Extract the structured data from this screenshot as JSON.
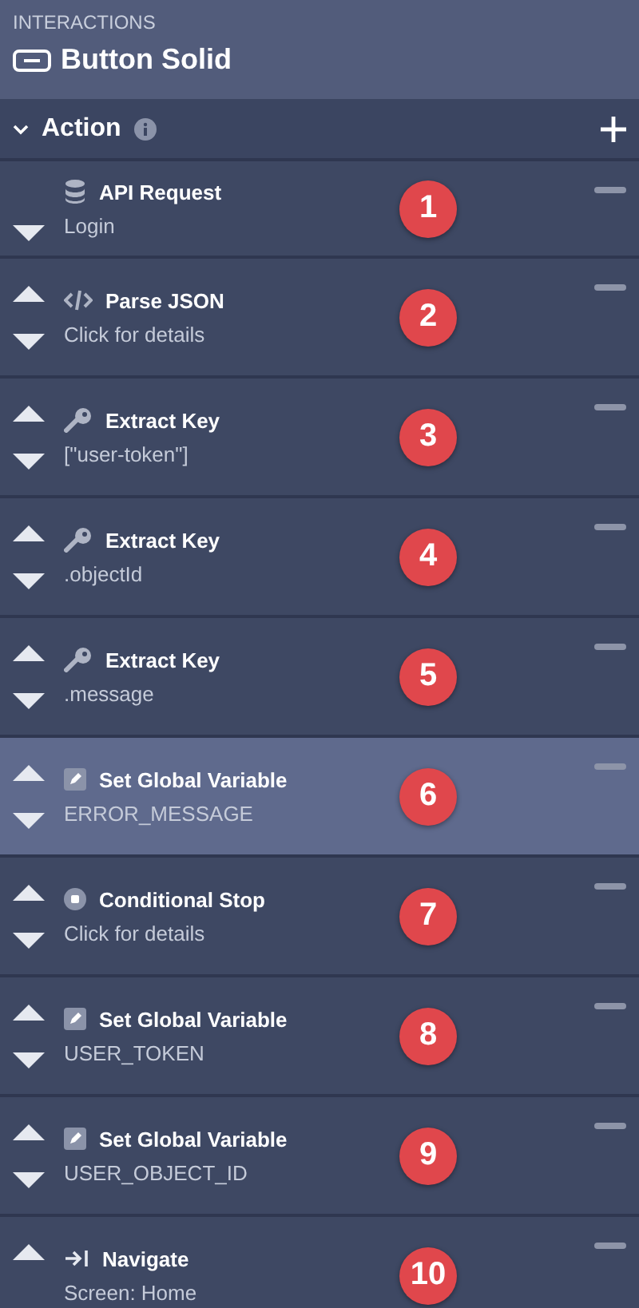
{
  "header": {
    "section": "INTERACTIONS",
    "title": "Button Solid"
  },
  "action_bar": {
    "label": "Action",
    "expanded": true
  },
  "actions": [
    {
      "kind": "database",
      "title": "API Request",
      "detail": "Login",
      "badge": "1",
      "selected": false,
      "can_move_up": false,
      "can_move_down": true
    },
    {
      "kind": "code",
      "title": "Parse JSON",
      "detail": "Click for details",
      "badge": "2",
      "selected": false,
      "can_move_up": true,
      "can_move_down": true
    },
    {
      "kind": "key",
      "title": "Extract Key",
      "detail": "[\"user-token\"]",
      "badge": "3",
      "selected": false,
      "can_move_up": true,
      "can_move_down": true
    },
    {
      "kind": "key",
      "title": "Extract Key",
      "detail": ".objectId",
      "badge": "4",
      "selected": false,
      "can_move_up": true,
      "can_move_down": true
    },
    {
      "kind": "key",
      "title": "Extract Key",
      "detail": ".message",
      "badge": "5",
      "selected": false,
      "can_move_up": true,
      "can_move_down": true
    },
    {
      "kind": "pencil",
      "title": "Set Global Variable",
      "detail": "ERROR_MESSAGE",
      "badge": "6",
      "selected": true,
      "can_move_up": true,
      "can_move_down": true
    },
    {
      "kind": "stop",
      "title": "Conditional Stop",
      "detail": "Click for details",
      "badge": "7",
      "selected": false,
      "can_move_up": true,
      "can_move_down": true
    },
    {
      "kind": "pencil",
      "title": "Set Global Variable",
      "detail": "USER_TOKEN",
      "badge": "8",
      "selected": false,
      "can_move_up": true,
      "can_move_down": true
    },
    {
      "kind": "pencil",
      "title": "Set Global Variable",
      "detail": "USER_OBJECT_ID",
      "badge": "9",
      "selected": false,
      "can_move_up": true,
      "can_move_down": true
    },
    {
      "kind": "navigate",
      "title": "Navigate",
      "detail": "Screen: Home",
      "badge": "10",
      "selected": false,
      "can_move_up": true,
      "can_move_down": false
    }
  ]
}
